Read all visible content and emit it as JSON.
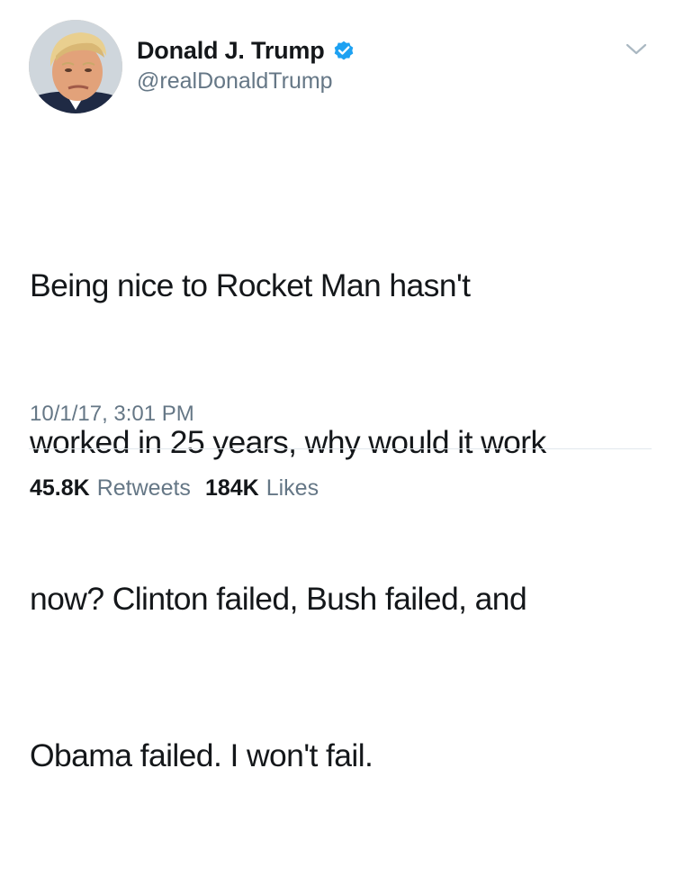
{
  "tweet": {
    "author": {
      "display_name": "Donald J. Trump",
      "handle": "@realDonaldTrump",
      "verified": true,
      "avatar_icon": "profile-photo"
    },
    "menu_icon": "chevron-down-icon",
    "lines": [
      "Being nice to Rocket Man hasn't",
      "worked in 25 years, why would it work",
      "now? Clinton failed, Bush failed, and",
      "Obama failed. I won't fail."
    ],
    "timestamp": "10/1/17, 3:01 PM",
    "stats": {
      "retweets_count": "45.8K",
      "retweets_label": "Retweets",
      "likes_count": "184K",
      "likes_label": "Likes"
    }
  },
  "colors": {
    "text_primary": "#14171a",
    "text_secondary": "#657786",
    "verified_blue": "#1da1f2",
    "divider": "#e1e8ed"
  }
}
